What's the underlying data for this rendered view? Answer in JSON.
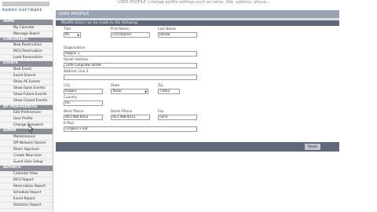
{
  "logo": {
    "text": "RANDO SOFTWARE"
  },
  "top_description": "USER PROFILE  |  change profile settings such as name, title, address, phone...",
  "sidebar": {
    "sections": [
      {
        "title": "HOME",
        "items": [
          "My Calendar",
          "Message Board"
        ]
      },
      {
        "title": "CONFERENCE",
        "items": [
          "New Reservation",
          "MCU Reservation",
          "Load Reservation"
        ]
      },
      {
        "title": "EVENTS",
        "items": [
          "New Event",
          "Event Search",
          "Show All Events",
          "Show Open Events",
          "Show Future Events",
          "Show Closed Events"
        ]
      },
      {
        "title": "MY PREFERENCES",
        "items": [
          "Edit Preferences",
          "User Profile",
          "Change Password"
        ]
      },
      {
        "title": "ADMIN",
        "items": [
          "Maintenance",
          "Off Network Rooms",
          "Room Approval",
          "Create New User",
          "Guest User Setup"
        ]
      },
      {
        "title": "REPORTS",
        "items": [
          "Calendar View",
          "MCU Report",
          "Reservation Report",
          "Schedule Report",
          "Event Report",
          "Statistics Report"
        ]
      }
    ]
  },
  "panel": {
    "title": "USER PROFILE",
    "subtitle": "Modifications can be made to the following",
    "reset_label": "Reset"
  },
  "form": {
    "title_label": "Title",
    "title_value": "Mr.",
    "first_name_label": "First Name",
    "first_name_value": "Christopher",
    "last_name_label": "Last Name",
    "last_name_value": "Randa",
    "organization_label": "Organization",
    "organization_value": "Region 1",
    "street_label": "Street Address",
    "street_value": "1309 Longview Street",
    "address2_label": "Address Line 2",
    "address2_value": "",
    "city_label": "City",
    "city_value": "Kilgore",
    "state_label": "State",
    "state_value": "Texas",
    "zip_label": "Zip",
    "zip_value": "75662",
    "country_label": "Country",
    "country_value": "US",
    "work_phone_label": "Work Phone",
    "work_phone_value": "903.988.6923",
    "home_phone_label": "Home Phone",
    "home_phone_value": "903.988.6923",
    "fax_label": "Fax",
    "fax_value": "none",
    "email_label": "E-Mail",
    "email_value": "c1f@esc1.net"
  },
  "colors": {
    "sidebar_header": "#8b8f98",
    "panel_title": "#9aa3b3",
    "panel_sub": "#5e6878"
  }
}
